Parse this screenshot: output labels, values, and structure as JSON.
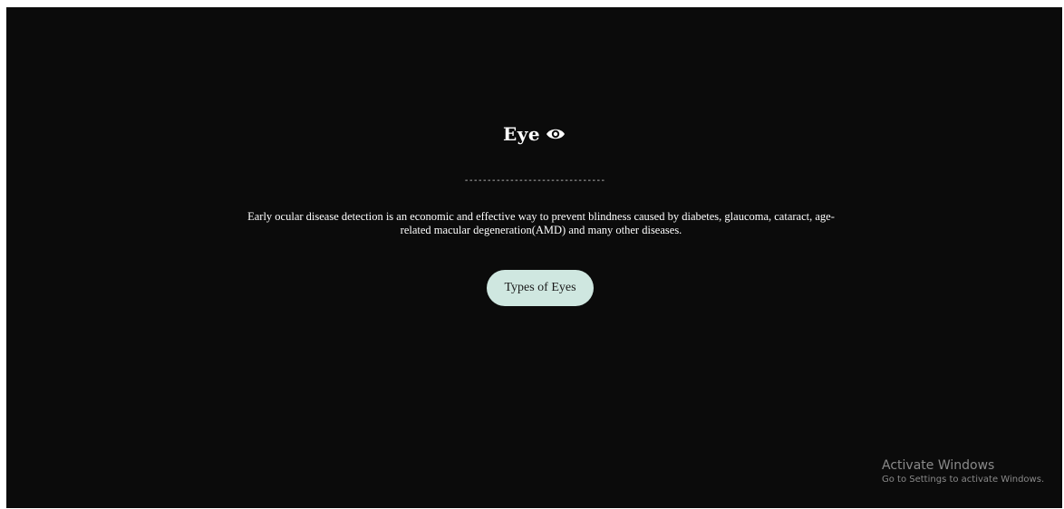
{
  "header": {
    "title": "Eye",
    "icon": "eye-icon"
  },
  "divider_text": "-------------------------------",
  "description": "Early ocular disease detection is an economic and effective way to prevent blindness caused by diabetes, glaucoma, cataract, age-related macular degeneration(AMD) and many other diseases.",
  "cta": {
    "label": "Types of Eyes"
  },
  "watermark": {
    "title": "Activate Windows",
    "subtitle": "Go to Settings to activate Windows."
  },
  "colors": {
    "background": "#0b0b0b",
    "button": "#cfe7e0",
    "text": "#ffffff"
  }
}
